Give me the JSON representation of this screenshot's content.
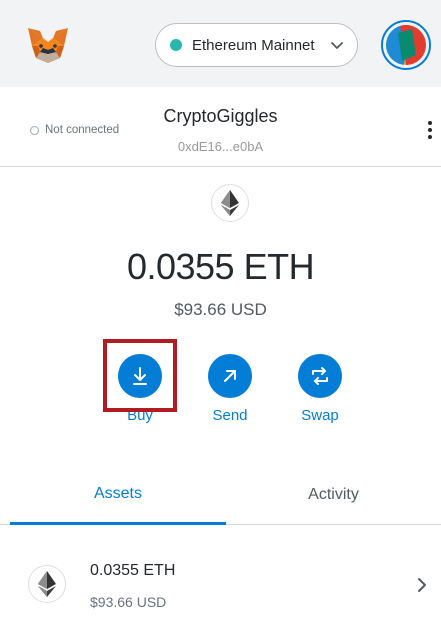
{
  "network": {
    "label": "Ethereum Mainnet",
    "dot_color": "#29b6af"
  },
  "account": {
    "connection_status": "Not connected",
    "name": "CryptoGiggles",
    "address": "0xdE16...e0bA"
  },
  "balance": {
    "amount": "0.0355",
    "unit": "ETH",
    "fiat": "$93.66 USD"
  },
  "actions": {
    "buy": "Buy",
    "send": "Send",
    "swap": "Swap"
  },
  "tabs": {
    "assets": "Assets",
    "activity": "Activity",
    "active": "assets"
  },
  "assets": [
    {
      "amount": "0.0355 ETH",
      "fiat": "$93.66 USD",
      "icon": "ethereum-icon"
    }
  ],
  "colors": {
    "accent": "#037dd6",
    "highlight": "#b01c22",
    "header_bg": "#f2f3f4"
  }
}
